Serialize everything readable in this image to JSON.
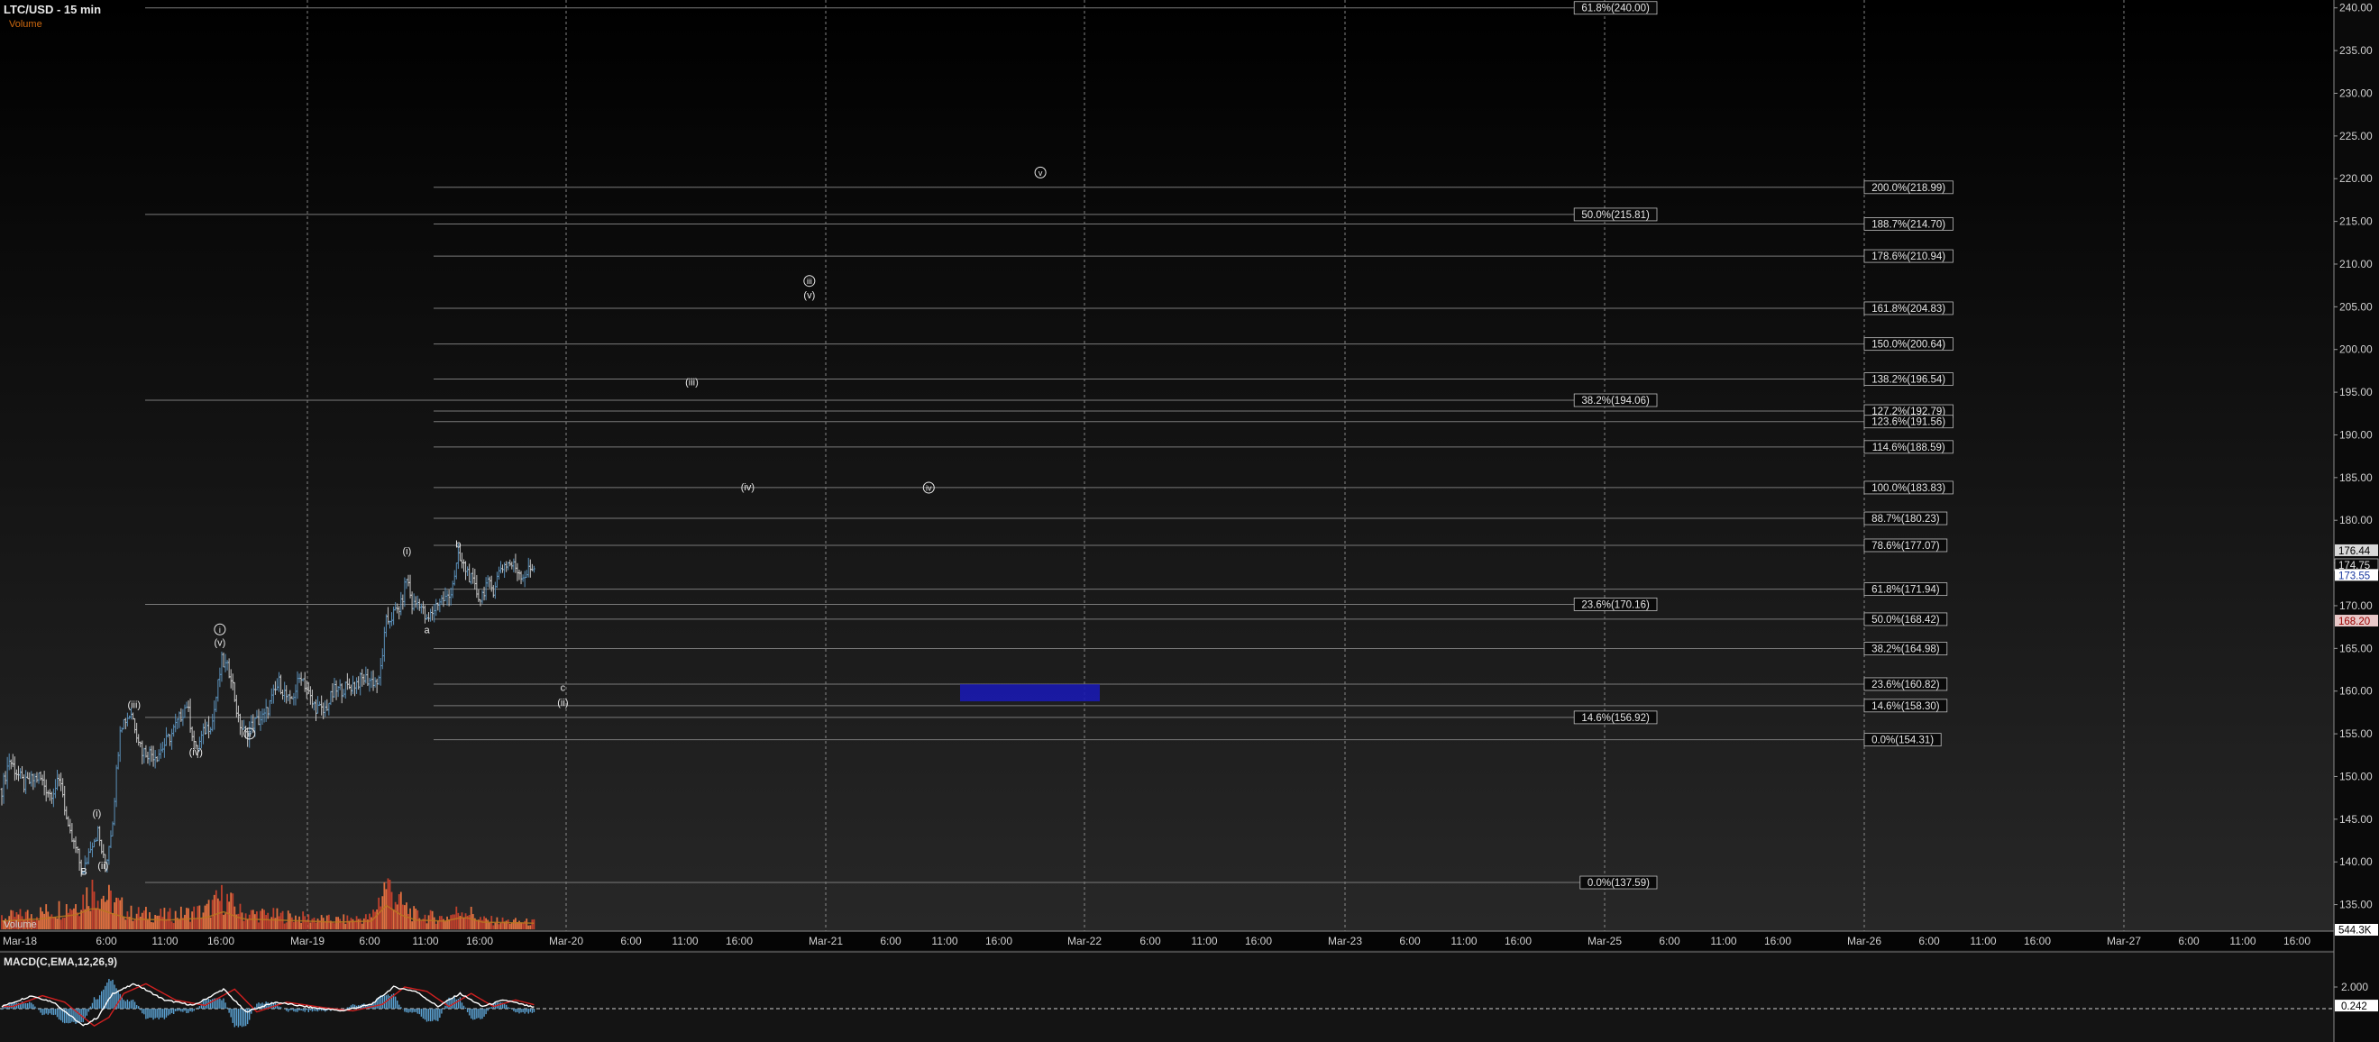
{
  "header": {
    "title": "LTC/USD - 15 min",
    "volume_label": "Volume",
    "volume_overlay_label": "Volume",
    "macd_label": "MACD(C,EMA,12,26,9)"
  },
  "colors": {
    "background": "#000000",
    "up_bar": "#5a8fb8",
    "down_bar": "#c8c8c8",
    "volume_up": "#c0402c",
    "volume_down": "#e07040",
    "macd_line": "#ffffff",
    "signal_line": "#d02020",
    "histogram": "#5aa0d0",
    "fib_line": "#7a7a7a",
    "target_box": "#1a1ab0",
    "last_price_bg": "#ffffff",
    "marker_bg": "#e8c8c8"
  },
  "axes": {
    "price_ticks": [
      "135.00",
      "140.00",
      "145.00",
      "150.00",
      "155.00",
      "160.00",
      "165.00",
      "170.00",
      "175.00",
      "180.00",
      "185.00",
      "190.00",
      "195.00",
      "200.00",
      "205.00",
      "210.00",
      "215.00",
      "220.00",
      "225.00",
      "230.00",
      "235.00",
      "240.00"
    ],
    "price_markers": [
      "176.44",
      "174.75",
      "173.55",
      "168.20"
    ],
    "volume_marker": "544.3K",
    "macd_ticks": [
      "2.000"
    ],
    "macd_marker": "0.242",
    "time_labels": [
      "Mar-18",
      "6:00",
      "11:00",
      "16:00",
      "Mar-19",
      "6:00",
      "11:00",
      "16:00",
      "Mar-20",
      "6:00",
      "11:00",
      "16:00",
      "Mar-21",
      "6:00",
      "11:00",
      "16:00",
      "Mar-22",
      "6:00",
      "11:00",
      "16:00",
      "Mar-23",
      "6:00",
      "11:00",
      "16:00",
      "Mar-25",
      "6:00",
      "11:00",
      "16:00",
      "Mar-26",
      "6:00",
      "11:00",
      "16:00",
      "Mar-27",
      "6:00",
      "11:00",
      "16:00"
    ]
  },
  "fib_retracements": [
    {
      "label": "61.8%(240.00)",
      "price": 240.0
    },
    {
      "label": "50.0%(215.81)",
      "price": 215.81
    },
    {
      "label": "38.2%(194.06)",
      "price": 194.06
    },
    {
      "label": "23.6%(170.16)",
      "price": 170.16
    },
    {
      "label": "14.6%(156.92)",
      "price": 156.92
    },
    {
      "label": "0.0%(137.59)",
      "price": 137.59
    }
  ],
  "fib_extensions": [
    {
      "label": "200.0%(218.99)",
      "price": 218.99
    },
    {
      "label": "188.7%(214.70)",
      "price": 214.7
    },
    {
      "label": "178.6%(210.94)",
      "price": 210.94
    },
    {
      "label": "161.8%(204.83)",
      "price": 204.83
    },
    {
      "label": "150.0%(200.64)",
      "price": 200.64
    },
    {
      "label": "138.2%(196.54)",
      "price": 196.54
    },
    {
      "label": "127.2%(192.79)",
      "price": 192.79
    },
    {
      "label": "123.6%(191.56)",
      "price": 191.56
    },
    {
      "label": "114.6%(188.59)",
      "price": 188.59
    },
    {
      "label": "100.0%(183.83)",
      "price": 183.83
    },
    {
      "label": "88.7%(180.23)",
      "price": 180.23
    },
    {
      "label": "78.6%(177.07)",
      "price": 177.07
    },
    {
      "label": "61.8%(171.94)",
      "price": 171.94
    },
    {
      "label": "50.0%(168.42)",
      "price": 168.42
    },
    {
      "label": "38.2%(164.98)",
      "price": 164.98
    },
    {
      "label": "23.6%(160.82)",
      "price": 160.82
    },
    {
      "label": "14.6%(158.30)",
      "price": 158.3
    },
    {
      "label": "0.0%(154.31)",
      "price": 154.31
    }
  ],
  "wave_labels": [
    {
      "text": "B",
      "circled": false,
      "slot": 22.2,
      "price": 138.5
    },
    {
      "text": "(i)",
      "circled": false,
      "slot": 25.7,
      "price": 145.3
    },
    {
      "text": "(ii)",
      "circled": false,
      "slot": 27.4,
      "price": 139.2
    },
    {
      "text": "(iii)",
      "circled": false,
      "slot": 35.8,
      "price": 158.0
    },
    {
      "text": "(iv)",
      "circled": false,
      "slot": 52.5,
      "price": 152.5
    },
    {
      "text": "i",
      "circled": true,
      "slot": 59.0,
      "price": 166.8
    },
    {
      "text": "(v)",
      "circled": false,
      "slot": 59.0,
      "price": 165.3
    },
    {
      "text": "ii",
      "circled": true,
      "slot": 67.0,
      "price": 154.6
    },
    {
      "text": "(i)",
      "circled": false,
      "slot": 109.6,
      "price": 176.0
    },
    {
      "text": "a",
      "circled": false,
      "slot": 115.0,
      "price": 166.8
    },
    {
      "text": "b",
      "circled": false,
      "slot": 123.5,
      "price": 176.8
    },
    {
      "text": "c",
      "circled": false,
      "slot": 151.8,
      "price": 160.0
    },
    {
      "text": "(ii)",
      "circled": false,
      "slot": 151.8,
      "price": 158.3
    },
    {
      "text": "(iii)",
      "circled": false,
      "slot": 186.7,
      "price": 195.8
    },
    {
      "text": "(iv)",
      "circled": false,
      "slot": 201.8,
      "price": 183.5
    },
    {
      "text": "iii",
      "circled": true,
      "slot": 218.5,
      "price": 207.6
    },
    {
      "text": "(v)",
      "circled": false,
      "slot": 218.5,
      "price": 206.0
    },
    {
      "text": "iv",
      "circled": true,
      "slot": 250.8,
      "price": 183.4
    },
    {
      "text": "v",
      "circled": true,
      "slot": 281.0,
      "price": 220.3
    }
  ],
  "chart_data": {
    "type": "candlestick",
    "title": "LTC/USD - 15 min",
    "ylim": [
      132.0,
      240.5
    ],
    "price_scale_side": "right",
    "target_zone": {
      "label": "c",
      "from_price": 158.8,
      "to_price": 160.8
    },
    "last_price": 173.55,
    "series": [
      {
        "name": "LTC/USD",
        "kind": "price",
        "anchors": [
          [
            0,
            148.5
          ],
          [
            2,
            152.0
          ],
          [
            6,
            149.0
          ],
          [
            10,
            150.0
          ],
          [
            13,
            148.0
          ],
          [
            16,
            149.5
          ],
          [
            18,
            143.5
          ],
          [
            20,
            141.5
          ],
          [
            22,
            138.5
          ],
          [
            24,
            142.0
          ],
          [
            26,
            143.5
          ],
          [
            28,
            139.2
          ],
          [
            30,
            145.0
          ],
          [
            32,
            156.0
          ],
          [
            35,
            157.5
          ],
          [
            38,
            153.0
          ],
          [
            42,
            152.5
          ],
          [
            46,
            155.0
          ],
          [
            50,
            158.5
          ],
          [
            52.5,
            153.0
          ],
          [
            55,
            155.5
          ],
          [
            57,
            156.5
          ],
          [
            59.5,
            163.5
          ],
          [
            62,
            162.0
          ],
          [
            64,
            156.5
          ],
          [
            66,
            154.8
          ],
          [
            68,
            156.2
          ],
          [
            71,
            157.0
          ],
          [
            75,
            161.0
          ],
          [
            78,
            158.5
          ],
          [
            81,
            162.0
          ],
          [
            84,
            158.5
          ],
          [
            87,
            157.5
          ],
          [
            90,
            160.0
          ],
          [
            94,
            160.5
          ],
          [
            98,
            161.5
          ],
          [
            102,
            161.0
          ],
          [
            104,
            168.0
          ],
          [
            106,
            169.0
          ],
          [
            108,
            170.0
          ],
          [
            109.6,
            173.5
          ],
          [
            111,
            170.0
          ],
          [
            113,
            170.5
          ],
          [
            115,
            168.0
          ],
          [
            118,
            170.5
          ],
          [
            121,
            171.0
          ],
          [
            123.5,
            175.5
          ],
          [
            126,
            174.0
          ],
          [
            128,
            172.0
          ],
          [
            129.5,
            170.8
          ],
          [
            131,
            172.5
          ],
          [
            133,
            172.0
          ],
          [
            135,
            174.5
          ],
          [
            137,
            175.0
          ],
          [
            139,
            174.5
          ],
          [
            141,
            173.5
          ],
          [
            143,
            174.2
          ],
          [
            144,
            174.75
          ]
        ]
      },
      {
        "name": "Volume",
        "kind": "volume",
        "anchors": [
          [
            0,
            0.25
          ],
          [
            10,
            0.35
          ],
          [
            20,
            0.55
          ],
          [
            25,
            0.9
          ],
          [
            30,
            0.6
          ],
          [
            35,
            0.35
          ],
          [
            45,
            0.3
          ],
          [
            55,
            0.4
          ],
          [
            60,
            0.7
          ],
          [
            65,
            0.35
          ],
          [
            75,
            0.3
          ],
          [
            90,
            0.2
          ],
          [
            100,
            0.25
          ],
          [
            104,
            1.0
          ],
          [
            108,
            0.55
          ],
          [
            112,
            0.3
          ],
          [
            120,
            0.25
          ],
          [
            125,
            0.45
          ],
          [
            130,
            0.2
          ],
          [
            144,
            0.15
          ]
        ]
      },
      {
        "name": "MACD(C,EMA,12,26,9)",
        "kind": "macd",
        "anchors": [
          [
            0,
            0.2
          ],
          [
            8,
            1.2
          ],
          [
            14,
            0.6
          ],
          [
            22,
            -1.6
          ],
          [
            26,
            -0.8
          ],
          [
            30,
            1.4
          ],
          [
            36,
            2.3
          ],
          [
            44,
            0.8
          ],
          [
            52,
            0.3
          ],
          [
            60,
            1.8
          ],
          [
            66,
            -0.3
          ],
          [
            74,
            0.6
          ],
          [
            84,
            0.1
          ],
          [
            92,
            -0.2
          ],
          [
            100,
            0.4
          ],
          [
            106,
            2.0
          ],
          [
            112,
            1.6
          ],
          [
            118,
            0.2
          ],
          [
            124,
            1.4
          ],
          [
            130,
            0.2
          ],
          [
            136,
            0.8
          ],
          [
            144,
            0.1
          ]
        ]
      }
    ]
  }
}
